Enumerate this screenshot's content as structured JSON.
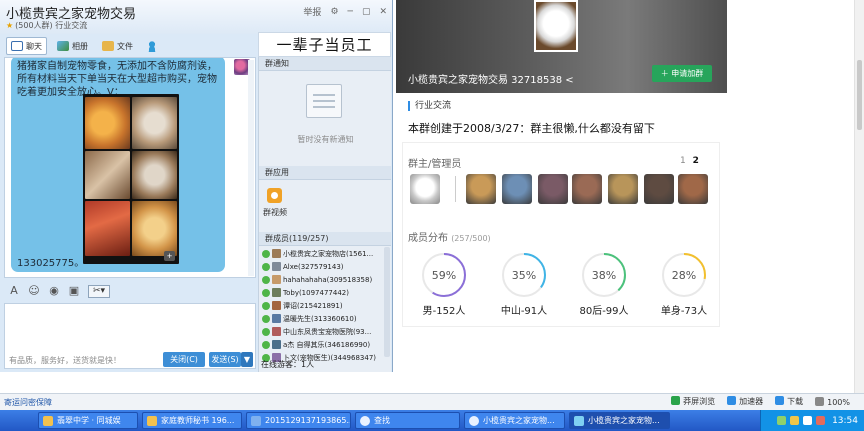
{
  "chat_window": {
    "title": "小榄贵宾之家宠物交易",
    "member_info": "(500人群)",
    "category": "行业交流",
    "report_label": "举报",
    "tabs": [
      {
        "label": "聊天"
      },
      {
        "label": "相册"
      },
      {
        "label": "文件"
      }
    ],
    "announcement_title": "一辈子当员工",
    "message_text": "猪猪家自制宠物零食，无添加不含防腐剂诶，所有材料当天下单当天在大型超市购买，宠物吃着更加安全放心。V：",
    "message_phone": "133025775。",
    "input_hint": "有品质，服务好，送货就是快！",
    "close_button": "关闭(C)",
    "send_button": "发送(S)",
    "send_more": "▼",
    "toolbar": {
      "font_icon": "A",
      "emoji_icon": "☺",
      "shake_icon": "◉",
      "image_icon": "▣",
      "screenshot_icon": "✂▾"
    }
  },
  "side_panel": {
    "notice_header": "群通知",
    "notice_empty": "暂时没有新通知",
    "apps_header": "群应用",
    "app_label": "群视频",
    "members_header": "群成员(119/257)",
    "members": [
      {
        "name": "小榄贵宾之家宠物店(1561...",
        "color": "#9c7b58"
      },
      {
        "name": "Alxe(327579143)",
        "color": "#7f8a99"
      },
      {
        "name": "hahahahaha(309518358)",
        "color": "#c69a6a"
      },
      {
        "name": "Toby(1097477442)",
        "color": "#6d7d5c"
      },
      {
        "name": "谭诏(215421891)",
        "color": "#a3643f"
      },
      {
        "name": "温暖先生(313360610)",
        "color": "#5a7aa3"
      },
      {
        "name": "中山东凤贵宝宠物医院(93...",
        "color": "#b05b5b"
      },
      {
        "name": "a杰  自得其乐(346186990)",
        "color": "#4a6e8a"
      },
      {
        "name": "卜文(宠物医生)(344968347)",
        "color": "#8b6fa8"
      }
    ],
    "visitors": "在线游客：1人"
  },
  "profile": {
    "group_name_id": "小榄贵宾之家宠物交易 32718538",
    "join_button": "申请加群",
    "tag": "行业交流",
    "description": "本群创建于2008/3/27：群主很懒,什么都没有留下",
    "admins_title": "群主/管理员",
    "pages": [
      "1",
      "2"
    ],
    "current_page": "2",
    "admins": [
      {
        "color": "#e2e2e2"
      },
      {
        "color": "#c99a58"
      },
      {
        "color": "#6d8fb5"
      },
      {
        "color": "#7a5a66"
      },
      {
        "color": "#9a6a55"
      },
      {
        "color": "#b8955a"
      },
      {
        "color": "#5e4b41"
      },
      {
        "color": "#a06848"
      }
    ],
    "members_title": "成员分布",
    "members_count": "(257/500)",
    "stats": [
      {
        "percent": 59,
        "label": "男-152人",
        "color": "#8b6fd8"
      },
      {
        "percent": 35,
        "label": "中山-91人",
        "color": "#3fb4e6"
      },
      {
        "percent": 38,
        "label": "80后-99人",
        "color": "#4cc27c"
      },
      {
        "percent": 28,
        "label": "单身-73人",
        "color": "#f2c02e"
      }
    ]
  },
  "browser_status": {
    "left_link": "寄运问密保障",
    "items": [
      {
        "label": "莽屏浏览",
        "color": "#2aa34a"
      },
      {
        "label": "加速器",
        "color": "#2f8de4"
      },
      {
        "label": "下载",
        "color": "#2f8de4"
      },
      {
        "label": "100%",
        "color": "#888888"
      }
    ]
  },
  "taskbar": {
    "items": [
      {
        "label": "翡翠中学 · 同城娱",
        "width": 100,
        "kind": ""
      },
      {
        "label": "家庭教师秘书 196...",
        "width": 100,
        "kind": ""
      },
      {
        "label": "2015129137193865...",
        "width": 105,
        "kind": "img"
      },
      {
        "label": "查找",
        "width": 105,
        "kind": "qq"
      },
      {
        "label": "小榄贵宾之家宠物...",
        "width": 101,
        "kind": "qq"
      },
      {
        "label": "小榄贵宾之家宠物...",
        "width": 101,
        "kind": "ie active"
      }
    ],
    "clock": "13:54"
  }
}
